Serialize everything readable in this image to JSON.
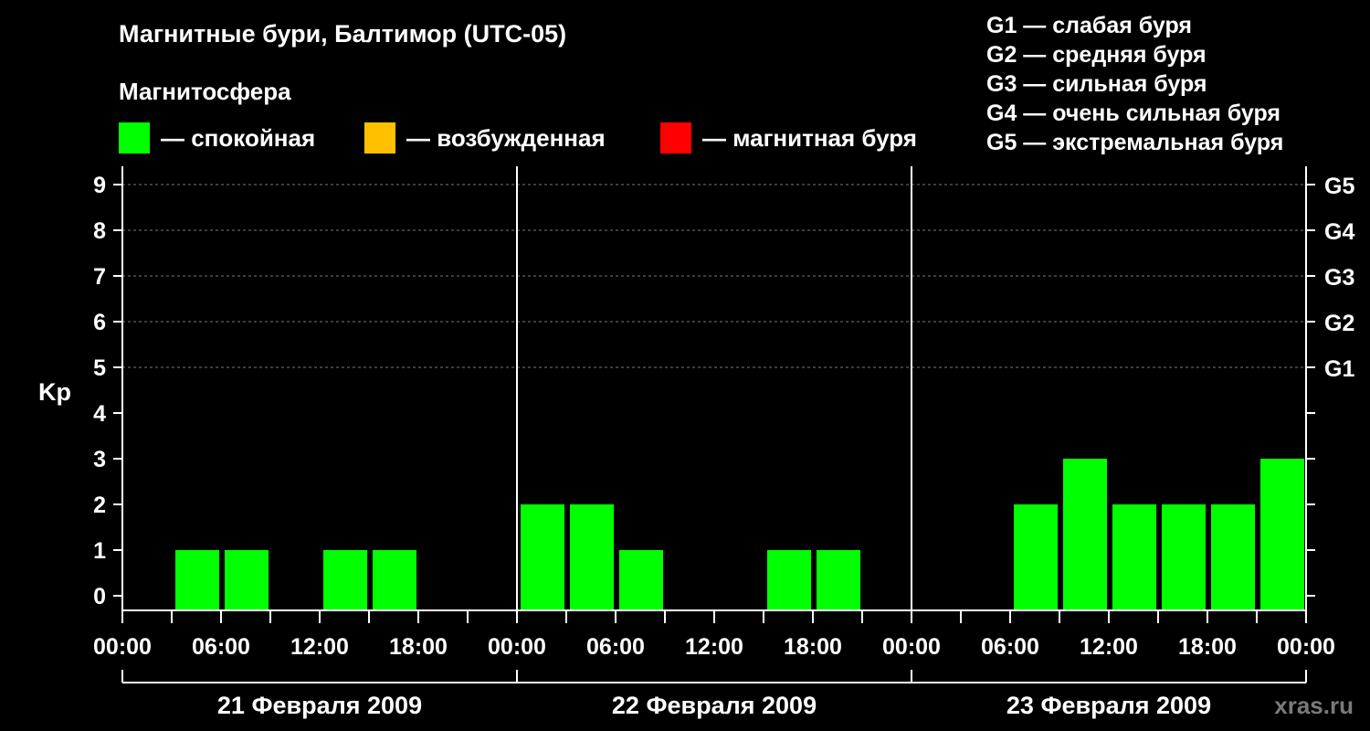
{
  "title": "Магнитные бури, Балтимор (UTC-05)",
  "legend": {
    "title": "Магнитосфера",
    "items": [
      {
        "label": "— спокойная",
        "color": "#00ff00"
      },
      {
        "label": "— возбужденная",
        "color": "#ffc000"
      },
      {
        "label": "— магнитная буря",
        "color": "#ff0000"
      }
    ]
  },
  "storm_legend": [
    "G1 — слабая буря",
    "G2 — средняя буря",
    "G3 — сильная буря",
    "G4 — очень сильная буря",
    "G5 — экстремальная буря"
  ],
  "watermark": "xras.ru",
  "chart_data": {
    "type": "bar",
    "ylabel": "Kp",
    "ylim": [
      0,
      9
    ],
    "y_ticks": [
      "0",
      "1",
      "2",
      "3",
      "4",
      "5",
      "6",
      "7",
      "8",
      "9"
    ],
    "right_ticks": [
      {
        "kp": 5,
        "label": "G1"
      },
      {
        "kp": 6,
        "label": "G2"
      },
      {
        "kp": 7,
        "label": "G3"
      },
      {
        "kp": 8,
        "label": "G4"
      },
      {
        "kp": 9,
        "label": "G5"
      }
    ],
    "x_tick_labels": [
      "00:00",
      "06:00",
      "12:00",
      "18:00",
      "00:00",
      "06:00",
      "12:00",
      "18:00",
      "00:00",
      "06:00",
      "12:00",
      "18:00",
      "00:00"
    ],
    "days": [
      "21 Февраля 2009",
      "22 Февраля 2009",
      "23 Февраля 2009"
    ],
    "interval_hours": 3,
    "series": [
      {
        "color": "#00ff00",
        "values": [
          0,
          1,
          1,
          0,
          1,
          1,
          0,
          0,
          2,
          2,
          1,
          0,
          0,
          1,
          1,
          0,
          0,
          0,
          2,
          3,
          2,
          2,
          2,
          3
        ]
      }
    ],
    "grid": true
  }
}
